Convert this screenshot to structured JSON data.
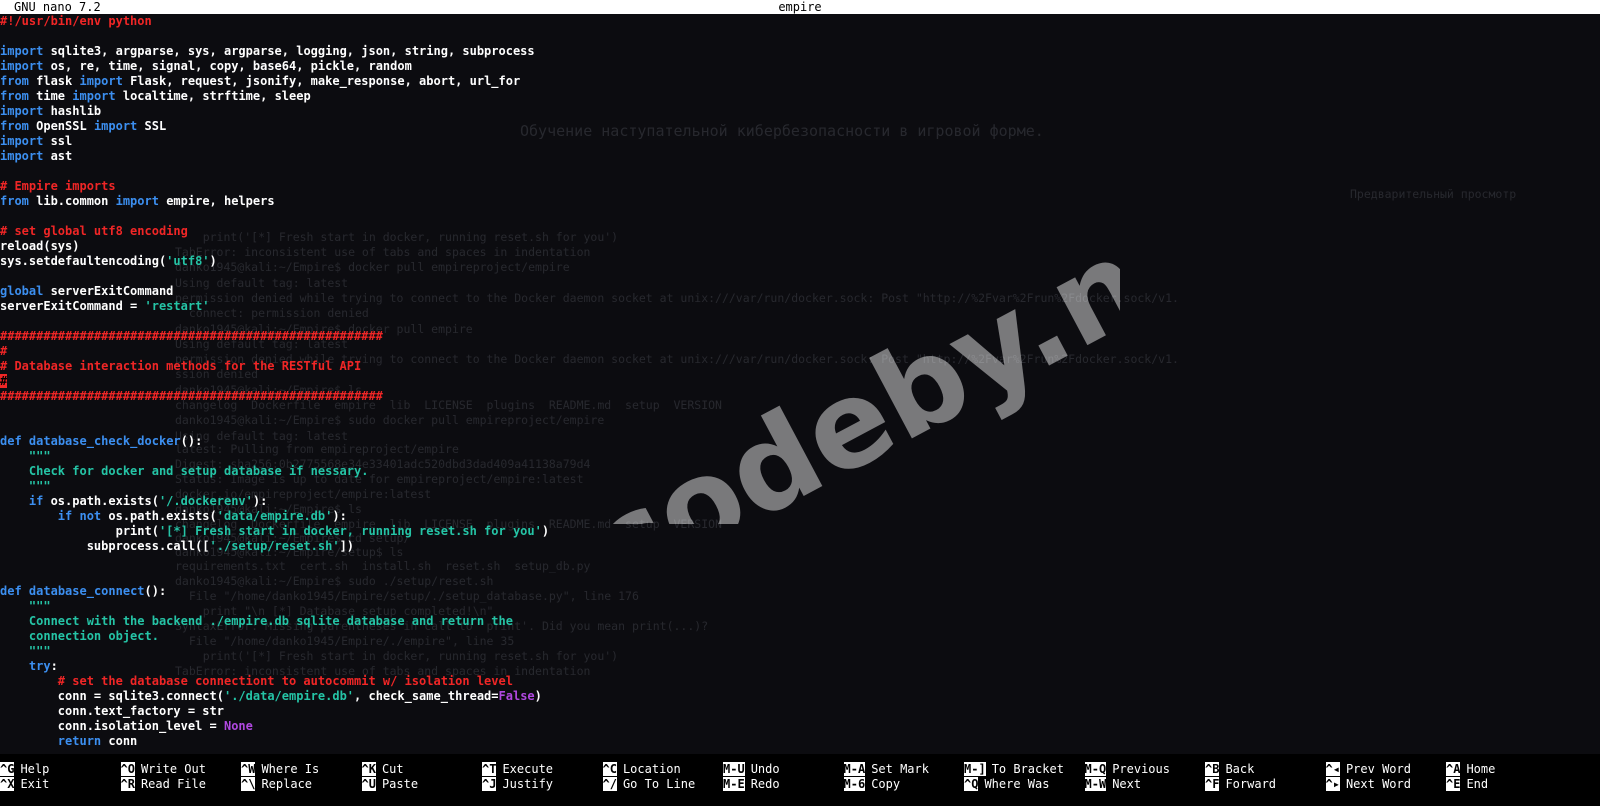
{
  "titlebar": {
    "version": "GNU nano 7.2",
    "filename": "empire"
  },
  "watermark": "codeby.net",
  "colors": {
    "keyword": "#3c8ff0",
    "string": "#25c4a6",
    "comment": "#f02626",
    "constant": "#b048e0",
    "background": "#0c0c10"
  },
  "ghost_lines": [
    "Обучение наступательной кибербезопасности в игровой форме.",
    "Предварительный просмотр",
    "    print('[*] Fresh start in docker, running reset.sh for you')",
    "TabError: inconsistent use of tabs and spaces in indentation",
    "danko1945@kali:~/Empire$ docker pull empireproject/empire",
    "Using default tag: latest",
    "permission denied while trying to connect to the Docker daemon socket at unix:///var/run/docker.sock: Post \"http://%2Fvar%2Frun%2Fdocker.sock/v1.",
    "  connect: permission denied",
    "danko1945@kali:~/Empire$ docker pull empire",
    "Using default tag: latest",
    "permission denied while trying to connect to the Docker daemon socket at unix:///var/run/docker.sock: Post \"http://%2Fvar%2Frun%2Fdocker.sock/v1.",
    "ssion denied",
    "danko1945@kali:~/Empire$ ls",
    "changelog  Dockerfile  empire  lib  LICENSE  plugins  README.md  setup  VERSION",
    "danko1945@kali:~/Empire$ sudo docker pull empireproject/empire",
    "Using default tag: latest",
    "latest: Pulling from empireproject/empire",
    "Digest: sha256:0b2775568e34e33401adc520dbd3dad409a41138a79d4",
    "Status: Image is up to date for empireproject/empire:latest",
    "docker.io/empireproject/empire:latest",
    "danko1945@kali:~/Empire$ ls",
    "changelog  Dockerfile  empire  lib  LICENSE  plugins  README.md  setup  VERSION",
    "danko1945@kali:~/Empire$ cd setup/",
    "danko1945@kali:~/Empire/setup$ ls",
    "requirements.txt  cert.sh  install.sh  reset.sh  setup_db.py",
    "danko1945@kali:~/Empire$ sudo ./setup/reset.sh",
    "  File \"/home/danko1945/Empire/setup/./setup_database.py\", line 176",
    "    print \"\\n [*] Database setup completed!\\n\"",
    "SyntaxError: Missing parentheses in call to 'print'. Did you mean print(...)?",
    "  File \"/home/danko1945/Empire/./empire\", line 35",
    "    print('[*] Fresh start in docker, running reset.sh for you')",
    "TabError: inconsistent use of tabs and spaces in indentation"
  ],
  "code_lines": [
    [
      [
        "c",
        "#!/usr/bin/env python"
      ]
    ],
    [],
    [
      [
        "k",
        "import"
      ],
      [
        "",
        " sqlite3, argparse, sys, argparse, logging, json, string, subprocess"
      ]
    ],
    [
      [
        "k",
        "import"
      ],
      [
        "",
        " os, re, time, signal, copy, base64, pickle, random"
      ]
    ],
    [
      [
        "k",
        "from"
      ],
      [
        "",
        " flask "
      ],
      [
        "k",
        "import"
      ],
      [
        "",
        " Flask, request, jsonify, make_response, abort, url_for"
      ]
    ],
    [
      [
        "k",
        "from"
      ],
      [
        "",
        " time "
      ],
      [
        "k",
        "import"
      ],
      [
        "",
        " localtime, strftime, sleep"
      ]
    ],
    [
      [
        "k",
        "import"
      ],
      [
        "",
        " hashlib"
      ]
    ],
    [
      [
        "k",
        "from"
      ],
      [
        "",
        " OpenSSL "
      ],
      [
        "k",
        "import"
      ],
      [
        "",
        " SSL"
      ]
    ],
    [
      [
        "k",
        "import"
      ],
      [
        "",
        " ssl"
      ]
    ],
    [
      [
        "k",
        "import"
      ],
      [
        "",
        " ast"
      ]
    ],
    [],
    [
      [
        "c",
        "# Empire imports"
      ]
    ],
    [
      [
        "k",
        "from"
      ],
      [
        "",
        " lib.common "
      ],
      [
        "k",
        "import"
      ],
      [
        "",
        " empire, helpers"
      ]
    ],
    [],
    [
      [
        "c",
        "# set global utf8 encoding"
      ]
    ],
    [
      [
        "",
        "reload(sys)"
      ]
    ],
    [
      [
        "",
        "sys.setdefaultencoding("
      ],
      [
        "s",
        "'utf8'"
      ],
      [
        "",
        ")"
      ]
    ],
    [],
    [
      [
        "k",
        "global"
      ],
      [
        "",
        " serverExitCommand"
      ]
    ],
    [
      [
        "",
        "serverExitCommand = "
      ],
      [
        "s",
        "'restart'"
      ]
    ],
    [],
    [
      [
        "c",
        "#####################################################"
      ]
    ],
    [
      [
        "c",
        "#"
      ]
    ],
    [
      [
        "c",
        "# Database interaction methods for the RESTful API"
      ]
    ],
    [
      [
        "cursor",
        "#"
      ]
    ],
    [
      [
        "c",
        "#####################################################"
      ]
    ],
    [],
    [],
    [
      [
        "k",
        "def"
      ],
      [
        "",
        " "
      ],
      [
        "f",
        "database_check_docker"
      ],
      [
        "",
        "():"
      ]
    ],
    [
      [
        "d",
        "    \"\"\""
      ]
    ],
    [
      [
        "d",
        "    Check for docker and setup database if nessary."
      ]
    ],
    [
      [
        "d",
        "    \"\"\""
      ]
    ],
    [
      [
        "",
        "    "
      ],
      [
        "k",
        "if"
      ],
      [
        "",
        " os.path.exists("
      ],
      [
        "s",
        "'/.dockerenv'"
      ],
      [
        "",
        "):"
      ]
    ],
    [
      [
        "",
        "        "
      ],
      [
        "k",
        "if not"
      ],
      [
        "",
        " os.path.exists("
      ],
      [
        "s",
        "'data/empire.db'"
      ],
      [
        "",
        "):"
      ]
    ],
    [
      [
        "",
        "                print("
      ],
      [
        "s",
        "'[*] Fresh start in docker, running reset.sh for you'"
      ],
      [
        "",
        ")"
      ]
    ],
    [
      [
        "",
        "            subprocess.call(["
      ],
      [
        "s",
        "'./setup/reset.sh'"
      ],
      [
        "",
        "])"
      ]
    ],
    [],
    [],
    [
      [
        "k",
        "def"
      ],
      [
        "",
        " "
      ],
      [
        "f",
        "database_connect"
      ],
      [
        "",
        "():"
      ]
    ],
    [
      [
        "d",
        "    \"\"\""
      ]
    ],
    [
      [
        "d",
        "    Connect with the backend ./empire.db sqlite database and return the"
      ]
    ],
    [
      [
        "d",
        "    connection object."
      ]
    ],
    [
      [
        "d",
        "    \"\"\""
      ]
    ],
    [
      [
        "",
        "    "
      ],
      [
        "k",
        "try"
      ],
      [
        "",
        ":"
      ]
    ],
    [
      [
        "",
        "        "
      ],
      [
        "c",
        "# set the database connectiont to autocommit w/ isolation level"
      ]
    ],
    [
      [
        "",
        "        conn = sqlite3.connect("
      ],
      [
        "s",
        "'./data/empire.db'"
      ],
      [
        "",
        ", check_same_thread="
      ],
      [
        "n",
        "False"
      ],
      [
        "",
        ")"
      ]
    ],
    [
      [
        "",
        "        conn.text_factory = str"
      ]
    ],
    [
      [
        "",
        "        conn.isolation_level = "
      ],
      [
        "n",
        "None"
      ]
    ],
    [
      [
        "",
        "        "
      ],
      [
        "k",
        "return"
      ],
      [
        "",
        " conn"
      ]
    ]
  ],
  "shortcuts": [
    {
      "key": "^G",
      "label": "Help"
    },
    {
      "key": "^X",
      "label": "Exit"
    },
    {
      "key": "^O",
      "label": "Write Out"
    },
    {
      "key": "^R",
      "label": "Read File"
    },
    {
      "key": "^W",
      "label": "Where Is"
    },
    {
      "key": "^\\",
      "label": "Replace"
    },
    {
      "key": "^K",
      "label": "Cut"
    },
    {
      "key": "^U",
      "label": "Paste"
    },
    {
      "key": "^T",
      "label": "Execute"
    },
    {
      "key": "^J",
      "label": "Justify"
    },
    {
      "key": "^C",
      "label": "Location"
    },
    {
      "key": "^/",
      "label": "Go To Line"
    },
    {
      "key": "M-U",
      "label": "Undo"
    },
    {
      "key": "M-E",
      "label": "Redo"
    },
    {
      "key": "M-A",
      "label": "Set Mark"
    },
    {
      "key": "M-6",
      "label": "Copy"
    },
    {
      "key": "M-]",
      "label": "To Bracket"
    },
    {
      "key": "^Q",
      "label": "Where Was"
    },
    {
      "key": "M-Q",
      "label": "Previous"
    },
    {
      "key": "M-W",
      "label": "Next"
    },
    {
      "key": "^B",
      "label": "Back"
    },
    {
      "key": "^F",
      "label": "Forward"
    },
    {
      "key": "^◂",
      "label": "Prev Word"
    },
    {
      "key": "^▸",
      "label": "Next Word"
    },
    {
      "key": "^A",
      "label": "Home"
    },
    {
      "key": "^E",
      "label": "End"
    }
  ]
}
